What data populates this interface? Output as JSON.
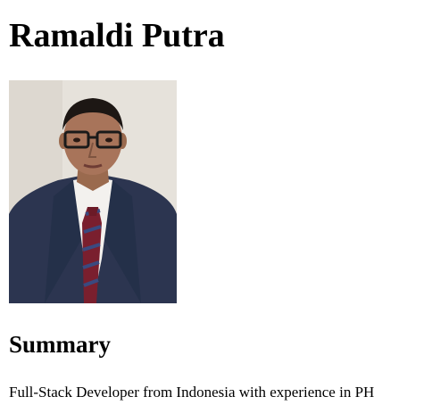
{
  "profile": {
    "name": "Ramaldi Putra"
  },
  "summary": {
    "heading": "Summary",
    "text": "Full-Stack Developer from Indonesia with experience in PH"
  },
  "icons": {
    "photo": "profile-photo"
  }
}
